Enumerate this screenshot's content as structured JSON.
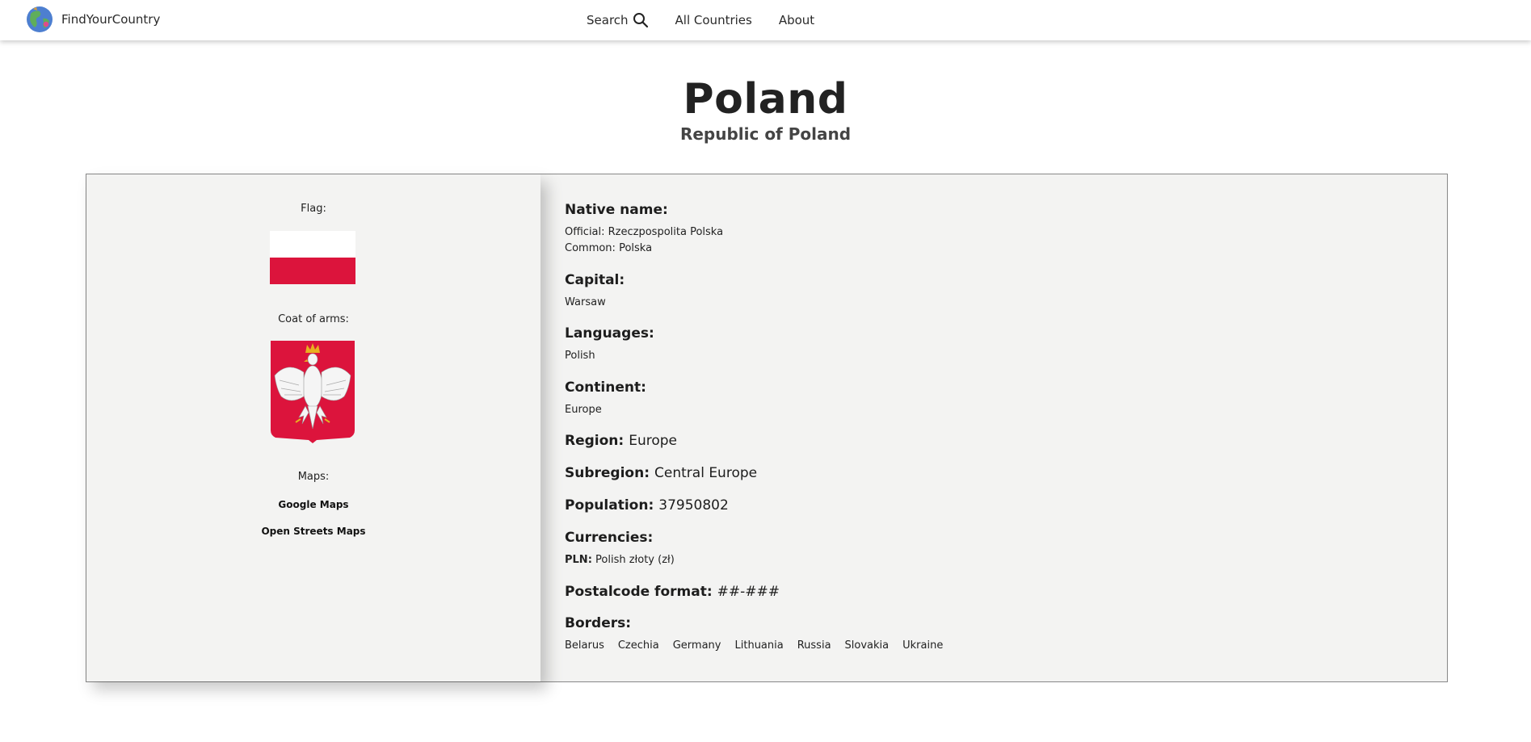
{
  "nav": {
    "brand": "FindYourCountry",
    "search_label": "Search",
    "all_countries_label": "All Countries",
    "about_label": "About"
  },
  "country": {
    "name": "Poland",
    "official_name": "Republic of Poland"
  },
  "left": {
    "flag_label": "Flag:",
    "coat_label": "Coat of arms:",
    "maps_label": "Maps:",
    "google_maps": "Google Maps",
    "osm": "Open Streets Maps",
    "flag_colors": [
      "#ffffff",
      "#dc143c"
    ]
  },
  "details": {
    "native_name_label": "Native name:",
    "native_official": "Official: Rzeczpospolita Polska",
    "native_common": "Common: Polska",
    "capital_label": "Capital:",
    "capital": "Warsaw",
    "languages_label": "Languages:",
    "languages": "Polish",
    "continent_label": "Continent:",
    "continent": "Europe",
    "region_label": "Region:",
    "region": "Europe",
    "subregion_label": "Subregion:",
    "subregion": "Central Europe",
    "population_label": "Population:",
    "population": "37950802",
    "currencies_label": "Currencies:",
    "currency_code": "PLN:",
    "currency_name": "Polish złoty (zł)",
    "postal_label": "Postalcode format:",
    "postal": "##-###",
    "borders_label": "Borders:",
    "borders": [
      "Belarus",
      "Czechia",
      "Germany",
      "Lithuania",
      "Russia",
      "Slovakia",
      "Ukraine"
    ]
  }
}
